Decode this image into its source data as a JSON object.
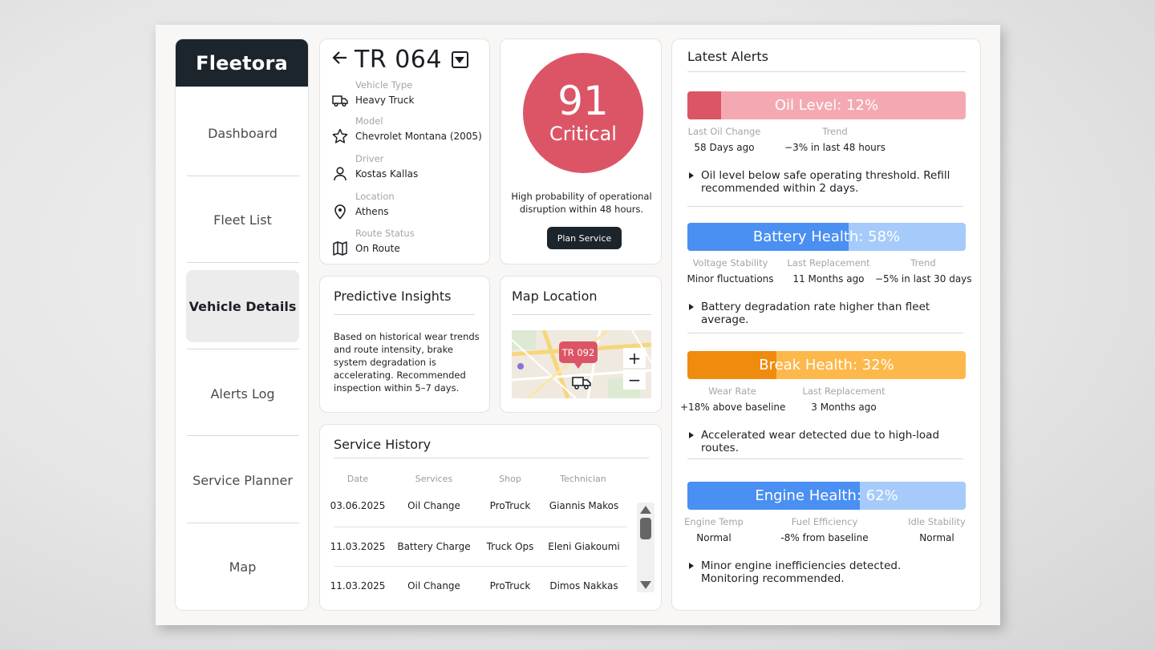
{
  "brand": "Fleetora",
  "nav": [
    {
      "label": "Dashboard",
      "active": false
    },
    {
      "label": "Fleet List",
      "active": false
    },
    {
      "label": "Vehicle Details",
      "active": true
    },
    {
      "label": "Alerts Log",
      "active": false
    },
    {
      "label": "Service Planner",
      "active": false
    },
    {
      "label": "Map",
      "active": false
    }
  ],
  "vehicle": {
    "id": "TR 064",
    "fields": [
      {
        "label": "Vehicle Type",
        "value": "Heavy Truck",
        "icon": "truck-icon"
      },
      {
        "label": "Model",
        "value": "Chevrolet Montana (2005)",
        "icon": "star-icon"
      },
      {
        "label": "Driver",
        "value": "Kostas Kallas",
        "icon": "person-icon"
      },
      {
        "label": "Location",
        "value": "Athens",
        "icon": "location-pin-icon"
      },
      {
        "label": "Route Status",
        "value": "On Route",
        "icon": "map-icon"
      }
    ]
  },
  "score": {
    "value": "91",
    "status": "Critical",
    "description": "High probability of operational disruption within 48 hours.",
    "button": "Plan Service",
    "color": "#dc5566"
  },
  "predictive": {
    "title": "Predictive Insights",
    "text": "Based on historical wear trends and route intensity, brake system degradation is accelerating. Recommended inspection within 5–7 days."
  },
  "map": {
    "title": "Map Location",
    "pin_label": "TR 092",
    "zoom_in": "+",
    "zoom_out": "−"
  },
  "history": {
    "title": "Service History",
    "columns": [
      "Date",
      "Services",
      "Shop",
      "Technician"
    ],
    "rows": [
      [
        "03.06.2025",
        "Oil Change",
        "ProTruck",
        "Giannis Makos"
      ],
      [
        "11.03.2025",
        "Battery Charge",
        "Truck Ops",
        "Eleni Giakoumi"
      ],
      [
        "11.03.2025",
        "Oil Change",
        "ProTruck",
        "Dimos Nakkas"
      ]
    ]
  },
  "alerts": {
    "title": "Latest Alerts",
    "items": [
      {
        "label": "Oil Level: 12%",
        "level": 0.12,
        "fill_color": "#dc5566",
        "track_color": "#f4a9b2",
        "metrics": [
          {
            "label": "Last Oil Change",
            "value": "58 Days ago"
          },
          {
            "label": "Trend",
            "value": "−3% in last 48 hours"
          }
        ],
        "note": "Oil level below safe operating threshold. Refill recommended within 2 days."
      },
      {
        "label": "Battery Health: 58%",
        "level": 0.58,
        "fill_color": "#4a8ff2",
        "track_color": "#a6cbfa",
        "metrics": [
          {
            "label": "Voltage Stability",
            "value": "Minor fluctuations"
          },
          {
            "label": "Last Replacement",
            "value": "11 Months ago"
          },
          {
            "label": "Trend",
            "value": "−5% in last 30 days"
          }
        ],
        "note": "Battery degradation rate higher than fleet average."
      },
      {
        "label": "Break Health: 32%",
        "level": 0.32,
        "fill_color": "#ef8c0e",
        "track_color": "#fdb84b",
        "metrics": [
          {
            "label": "Wear Rate",
            "value": "+18% above baseline"
          },
          {
            "label": "Last Replacement",
            "value": "3 Months ago"
          }
        ],
        "note": "Accelerated wear detected due to high-load routes."
      },
      {
        "label": "Engine Health: 62%",
        "level": 0.62,
        "fill_color": "#4a8ff2",
        "track_color": "#a6cbfa",
        "metrics": [
          {
            "label": "Engine Temp",
            "value": "Normal"
          },
          {
            "label": "Fuel Efficiency",
            "value": "-8% from baseline"
          },
          {
            "label": "Idle Stability",
            "value": "Normal"
          }
        ],
        "note": "Minor engine inefficiencies detected. Monitoring recommended."
      }
    ]
  }
}
